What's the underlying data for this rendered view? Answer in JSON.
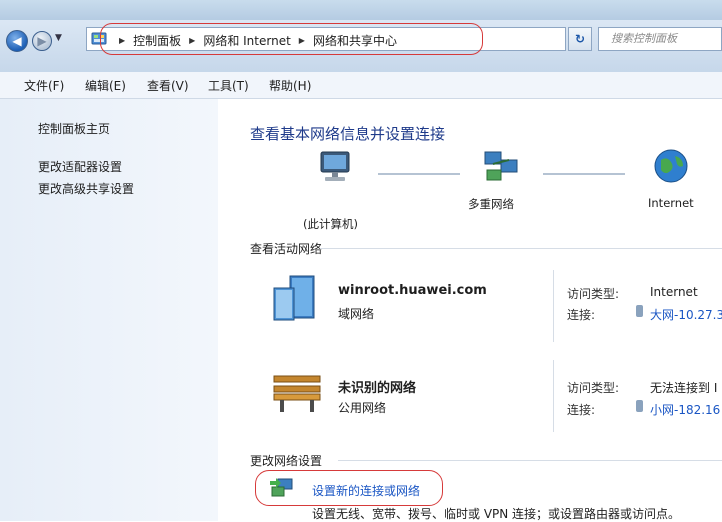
{
  "address": {
    "crumbs": [
      "控制面板",
      "网络和 Internet",
      "网络和共享中心"
    ],
    "search_placeholder": "搜索控制面板"
  },
  "menu": [
    "文件(F)",
    "编辑(E)",
    "查看(V)",
    "工具(T)",
    "帮助(H)"
  ],
  "sidebar": {
    "home": "控制面板主页",
    "links": [
      "更改适配器设置",
      "更改高级共享设置"
    ]
  },
  "main": {
    "title": "查看基本网络信息并设置连接",
    "map": {
      "computer": "(此计算机)",
      "network": "多重网络",
      "internet": "Internet"
    },
    "active_title": "查看活动网络",
    "networks": [
      {
        "name": "winroot.huawei.com",
        "type": "域网络",
        "access_label": "访问类型:",
        "access_value": "Internet",
        "conn_label": "连接:",
        "conn_value": "大网-10.27.3"
      },
      {
        "name": "未识别的网络",
        "type": "公用网络",
        "access_label": "访问类型:",
        "access_value": "无法连接到 I",
        "conn_label": "连接:",
        "conn_value": "小网-182.16"
      }
    ],
    "change_title": "更改网络设置",
    "new_connection_link": "设置新的连接或网络",
    "new_connection_desc": "设置无线、宽带、拨号、临时或 VPN 连接；或设置路由器或访问点。"
  },
  "colors": {
    "title_blue": "#1e3a8a",
    "link_blue": "#1a56c4",
    "highlight_red": "#d63a3a"
  }
}
